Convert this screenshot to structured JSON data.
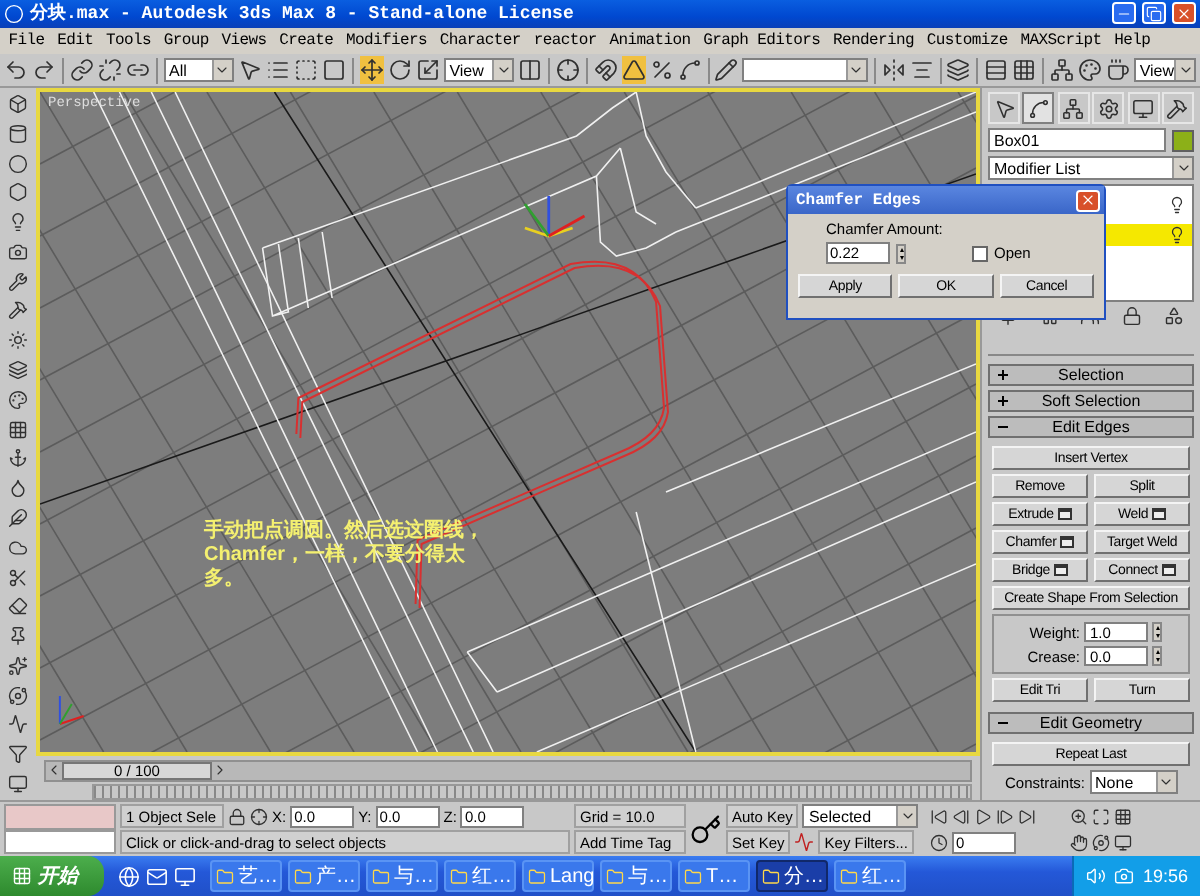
{
  "window": {
    "title": "分块.max - Autodesk 3ds Max 8  - Stand-alone License"
  },
  "menu": [
    "File",
    "Edit",
    "Tools",
    "Group",
    "Views",
    "Create",
    "Modifiers",
    "Character",
    "reactor",
    "Animation",
    "Graph Editors",
    "Rendering",
    "Customize",
    "MAXScript",
    "Help"
  ],
  "toolbar": {
    "selection_filter": "All",
    "reference_coordinates": "View",
    "render_view": "View"
  },
  "viewport": {
    "label": "Perspective",
    "active": true,
    "note": "手动把点调圆。然后选这圈线，Chamfer，一样，不要分得太多。"
  },
  "command_panel": {
    "tabs": [
      {
        "selected": false
      },
      {
        "selected": true
      },
      {
        "selected": false
      },
      {
        "selected": false
      },
      {
        "selected": false
      },
      {
        "selected": false
      }
    ],
    "object_name": "Box01",
    "modifier_list": "Modifier List",
    "stack": [
      {
        "selected": false
      },
      {
        "selected": true
      }
    ],
    "rollouts": [
      {
        "title": "Selection",
        "expanded": false
      },
      {
        "title": "Soft Selection",
        "expanded": false
      },
      {
        "title": "Edit Edges",
        "expanded": true,
        "content": [
          {
            "kind": "buttons",
            "rows": [
              [
                {
                  "label": "Insert Vertex",
                  "settings": false
                }
              ],
              [
                {
                  "label": "Remove",
                  "settings": false
                },
                {
                  "label": "Split",
                  "settings": false
                }
              ],
              [
                {
                  "label": "Extrude",
                  "settings": true
                },
                {
                  "label": "Weld",
                  "settings": true
                }
              ],
              [
                {
                  "label": "Chamfer",
                  "settings": true
                },
                {
                  "label": "Target Weld",
                  "settings": false
                }
              ],
              [
                {
                  "label": "Bridge",
                  "settings": true
                },
                {
                  "label": "Connect",
                  "settings": true
                }
              ],
              [
                {
                  "label": "Create Shape From Selection",
                  "settings": false
                }
              ]
            ]
          },
          {
            "kind": "spinners",
            "items": [
              {
                "label": "Weight:",
                "value": "1.0"
              },
              {
                "label": "Crease:",
                "value": "0.0"
              }
            ]
          },
          {
            "kind": "buttons",
            "rows": [
              [
                {
                  "label": "Edit Tri",
                  "settings": false
                },
                {
                  "label": "Turn",
                  "settings": false
                }
              ]
            ]
          }
        ]
      },
      {
        "title": "Edit Geometry",
        "expanded": true,
        "content": [
          {
            "kind": "buttons",
            "rows": [
              [
                {
                  "label": "Repeat Last",
                  "settings": false
                }
              ]
            ]
          },
          {
            "kind": "dropdown",
            "label": "Constraints:",
            "value": "None"
          }
        ]
      }
    ]
  },
  "dialog": {
    "title": "Chamfer Edges",
    "amount_label": "Chamfer Amount:",
    "amount": "0.22",
    "open": {
      "label": "Open",
      "checked": false
    },
    "buttons": [
      "Apply",
      "OK",
      "Cancel"
    ]
  },
  "time_slider": {
    "frame": "0 / 100",
    "level": 0
  },
  "status": {
    "selection": "1 Object Sele",
    "coords": [
      {
        "label": "X:",
        "value": "0.0"
      },
      {
        "label": "Y:",
        "value": "0.0"
      },
      {
        "label": "Z:",
        "value": "0.0"
      }
    ],
    "grid": "Grid = 10.0",
    "prompt": "Click or click-and-drag to select objects",
    "time_tag": "Add Time Tag",
    "auto_key": "Auto Key",
    "key_mode": "Selected",
    "set_key": "Set Key",
    "key_filters": "Key Filters...",
    "current_frame": "0"
  },
  "taskbar": {
    "start": "开始",
    "items": [
      {
        "label": "艺…",
        "selected": false
      },
      {
        "label": "产…",
        "selected": false
      },
      {
        "label": "与…",
        "selected": false
      },
      {
        "label": "红…",
        "selected": false
      },
      {
        "label": "Lang",
        "selected": false
      },
      {
        "label": "与…",
        "selected": false
      },
      {
        "label": "T…",
        "selected": false
      },
      {
        "label": "分…",
        "selected": true
      },
      {
        "label": "红…",
        "selected": false
      }
    ],
    "clock": "19:56"
  }
}
